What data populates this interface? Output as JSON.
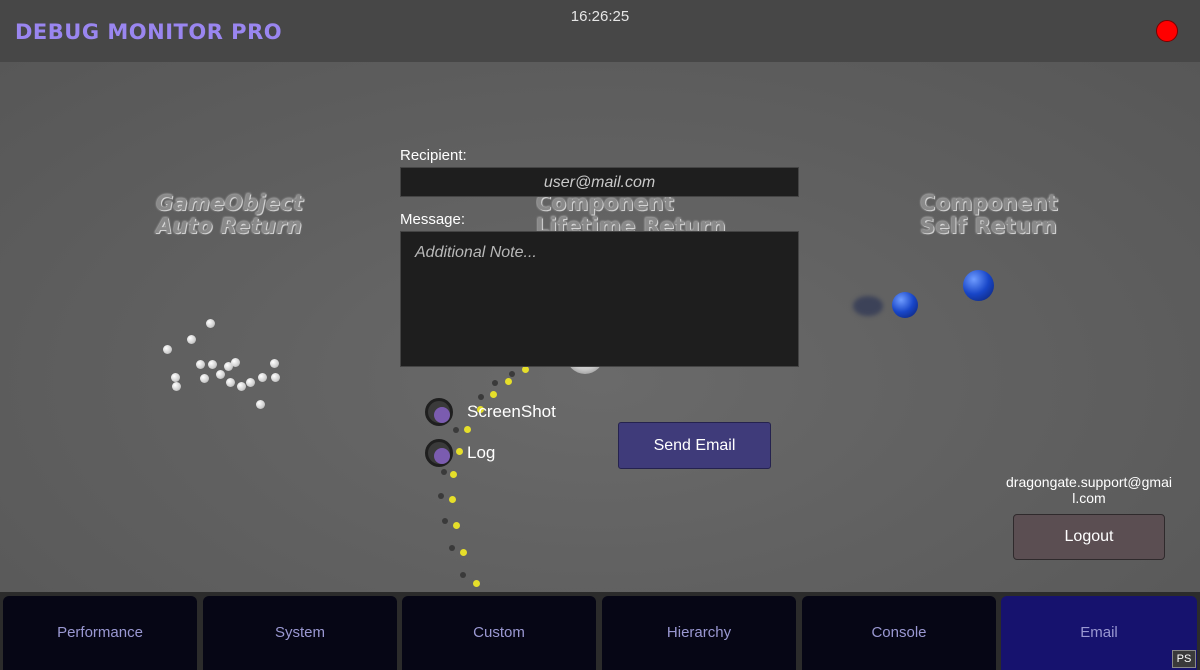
{
  "header": {
    "title": "DEBUG MONITOR PRO",
    "clock": "16:26:25",
    "record_color": "#ff0000"
  },
  "scene": {
    "labels": [
      {
        "text": "GameObject\nAuto Return"
      },
      {
        "text": "Component\nLifetime Return"
      },
      {
        "text": "Component\nSelf Return"
      }
    ]
  },
  "email_form": {
    "recipient_label": "Recipient:",
    "recipient_value": "user@mail.com",
    "message_label": "Message:",
    "message_placeholder": "Additional Note...",
    "options": [
      {
        "label": "ScreenShot",
        "checked": true
      },
      {
        "label": "Log",
        "checked": true
      }
    ],
    "send_label": "Send Email"
  },
  "account": {
    "email": "dragongate.support@gmail.com",
    "logout_label": "Logout"
  },
  "tabs": [
    {
      "label": "Performance",
      "active": false
    },
    {
      "label": "System",
      "active": false
    },
    {
      "label": "Custom",
      "active": false
    },
    {
      "label": "Hierarchy",
      "active": false
    },
    {
      "label": "Console",
      "active": false
    },
    {
      "label": "Email",
      "active": true
    }
  ],
  "badge": "PS",
  "colors": {
    "accent": "#9a86f0",
    "active_tab": "#16126e",
    "tab_text": "#9a98d2",
    "button": "#3f3b7a"
  }
}
